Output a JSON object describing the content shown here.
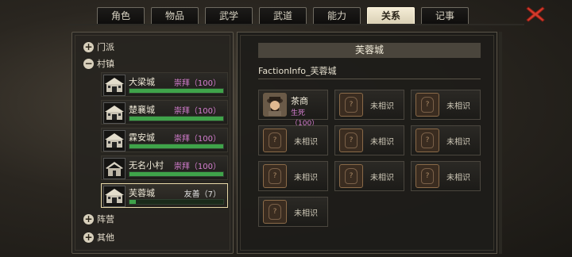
{
  "tabs": [
    {
      "label": "角色",
      "active": false
    },
    {
      "label": "物品",
      "active": false
    },
    {
      "label": "武学",
      "active": false
    },
    {
      "label": "武道",
      "active": false
    },
    {
      "label": "能力",
      "active": false
    },
    {
      "label": "关系",
      "active": true
    },
    {
      "label": "记事",
      "active": false
    }
  ],
  "sidebar": {
    "categories": [
      {
        "label": "门派",
        "toggle": "+"
      },
      {
        "label": "村镇",
        "toggle": "−"
      },
      {
        "label": "阵营",
        "toggle": "+"
      },
      {
        "label": "其他",
        "toggle": "+"
      }
    ],
    "towns": [
      {
        "name": "大梁城",
        "status": "崇拜（100）",
        "progress": 1.0,
        "selected": false
      },
      {
        "name": "楚襄城",
        "status": "崇拜（100）",
        "progress": 1.0,
        "selected": false
      },
      {
        "name": "霖安城",
        "status": "崇拜（100）",
        "progress": 1.0,
        "selected": false
      },
      {
        "name": "无名小村",
        "status": "崇拜（100）",
        "progress": 1.0,
        "selected": false
      },
      {
        "name": "芙蓉城",
        "status": "友善（7）",
        "progress": 0.07,
        "selected": true
      }
    ]
  },
  "detail": {
    "title": "芙蓉城",
    "subtitle": "FactionInfo_芙蓉城",
    "npcs": [
      {
        "name": "茶商",
        "relation": "生死（100）",
        "known": true
      },
      {
        "label": "未相识",
        "known": false
      },
      {
        "label": "未相识",
        "known": false
      },
      {
        "label": "未相识",
        "known": false
      },
      {
        "label": "未相识",
        "known": false
      },
      {
        "label": "未相识",
        "known": false
      },
      {
        "label": "未相识",
        "known": false
      },
      {
        "label": "未相识",
        "known": false
      },
      {
        "label": "未相识",
        "known": false
      },
      {
        "label": "未相识",
        "known": false
      }
    ]
  },
  "icons": {
    "close": "close-x-icon",
    "town": "town-gate-icon",
    "unknown": "unknown-portrait-icon"
  },
  "colors": {
    "relation_worship": "#d77fd2",
    "progress_green": "#3fa34a",
    "close_red": "#d33a2c"
  }
}
